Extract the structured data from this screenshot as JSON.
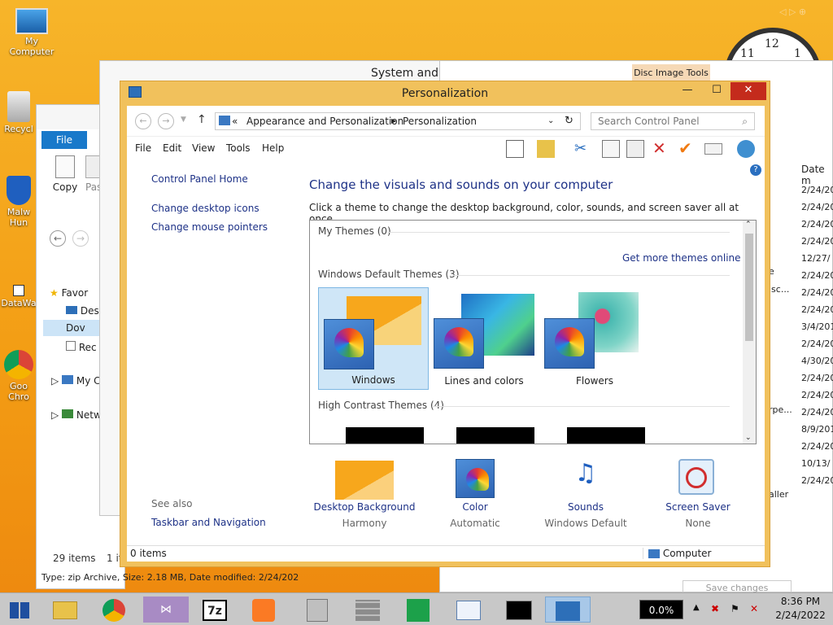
{
  "desktop": {
    "icons": [
      {
        "label": "My Computer"
      },
      {
        "label": "Recycl"
      },
      {
        "label": "Malw Hun"
      },
      {
        "label": "DataWa"
      },
      {
        "label": "Goo Chro"
      }
    ],
    "clock_numbers": [
      "12",
      "1",
      "11"
    ]
  },
  "background_windows": {
    "system_title": "System and S",
    "disc_tools": "Disc Image Tools",
    "explorer": {
      "file_tab": "File",
      "copy_label": "Copy",
      "paste_label": "Pas",
      "nav_items": [
        "Favor",
        "Des",
        "Dov",
        "Rec",
        "My C",
        "Netw"
      ],
      "items_count": "29 items",
      "items_count2": "1 it",
      "status_line": "Type: zip Archive, Size: 2.18 MB, Date modified: 2/24/202"
    },
    "right_list": {
      "header": "Date m",
      "dates": [
        "2/24/20",
        "2/24/20",
        "2/24/20",
        "2/24/20",
        "12/27/",
        "2/24/20",
        "2/24/20",
        "2/24/20",
        "3/4/201",
        "2/24/20",
        "4/30/20",
        "2/24/20",
        "2/24/20",
        "2/24/20",
        "8/9/201",
        "2/24/20",
        "10/13/",
        "2/24/20"
      ],
      "fragments": [
        "e",
        "isc...",
        "rpe...",
        "aller"
      ],
      "save_changes": "Save changes"
    }
  },
  "window": {
    "title": "Personalization",
    "minimize": "—",
    "maximize": "☐",
    "close": "✕",
    "breadcrumb": {
      "prefix": "«",
      "parts": [
        "Appearance and Personalization",
        "Personalization"
      ],
      "sep": "▶"
    },
    "search_placeholder": "Search Control Panel",
    "menu": [
      "File",
      "Edit",
      "View",
      "Tools",
      "Help"
    ],
    "sidebar": {
      "home": "Control Panel Home",
      "links": [
        "Change desktop icons",
        "Change mouse pointers"
      ],
      "see_also": "See also",
      "see_also_link": "Taskbar and Navigation"
    },
    "heading": "Change the visuals and sounds on your computer",
    "subheading": "Click a theme to change the desktop background, color, sounds, and screen saver all at once.",
    "themes_box": {
      "my_themes": "My Themes (0)",
      "get_more": "Get more themes online",
      "default_themes": "Windows Default Themes (3)",
      "themes": [
        {
          "label": "Windows",
          "selected": true
        },
        {
          "label": "Lines and colors",
          "selected": false
        },
        {
          "label": "Flowers",
          "selected": false
        }
      ],
      "high_contrast": "High Contrast Themes (4)"
    },
    "bottom": [
      {
        "link": "Desktop Background",
        "sub": "Harmony"
      },
      {
        "link": "Color",
        "sub": "Automatic"
      },
      {
        "link": "Sounds",
        "sub": "Windows Default"
      },
      {
        "link": "Screen Saver",
        "sub": "None"
      }
    ],
    "status": {
      "items": "0 items",
      "location": "Computer"
    }
  },
  "taskbar": {
    "apps": [
      "start-icon",
      "file-explorer-icon",
      "chrome-icon",
      "visual-studio-icon",
      "7zip-icon",
      "xampp-icon",
      "archive-icon",
      "firewall-icon",
      "store-icon",
      "resource-monitor-icon",
      "cmd-icon",
      "control-panel-icon"
    ],
    "sevenzip_label": "7z",
    "cpu": "0.0%",
    "time": "8:36 PM",
    "date": "2/24/2022"
  },
  "colors": {
    "accent_link": "#1e3287",
    "window_frame": "#f1c15c",
    "close_red": "#c42b1c"
  }
}
